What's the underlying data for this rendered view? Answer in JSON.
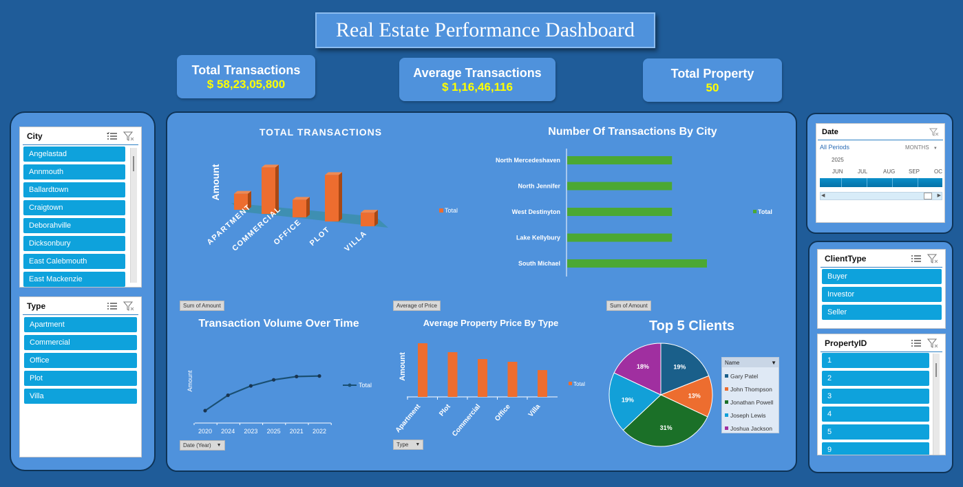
{
  "title": "Real Estate Performance Dashboard",
  "kpis": {
    "total_transactions": {
      "label": "Total Transactions",
      "value": "$ 58,23,05,800"
    },
    "average_transactions": {
      "label": "Average Transactions",
      "value": "$ 1,16,46,116"
    },
    "total_property": {
      "label": "Total Property",
      "value": "50"
    }
  },
  "city_slicer": {
    "title": "City",
    "items": [
      "Angelastad",
      "Annmouth",
      "Ballardtown",
      "Craigtown",
      "Deborahville",
      "Dicksonbury",
      "East Calebmouth",
      "East Mackenzie"
    ]
  },
  "type_slicer": {
    "title": "Type",
    "items": [
      "Apartment",
      "Commercial",
      "Office",
      "Plot",
      "Villa"
    ]
  },
  "date_slicer": {
    "title": "Date",
    "all_periods": "All Periods",
    "level": "MONTHS",
    "year": "2025",
    "months": [
      "JUN",
      "JUL",
      "AUG",
      "SEP",
      "OC"
    ]
  },
  "clienttype_slicer": {
    "title": "ClientType",
    "items": [
      "Buyer",
      "Investor",
      "Seller"
    ]
  },
  "propertyid_slicer": {
    "title": "PropertyID",
    "items": [
      "1",
      "2",
      "3",
      "4",
      "5",
      "9"
    ]
  },
  "colors": {
    "background": "#1f5c99",
    "panel": "#4f92dc",
    "bar_orange": "#ed6d2f",
    "bar_green": "#4ba833",
    "slicer_item": "#0ea2dc",
    "kpi_value": "#ffff00"
  },
  "pivot_buttons": {
    "sum_amount": "Sum of Amount",
    "avg_price": "Average of Price",
    "date_year": "Date (Year)",
    "type": "Type",
    "name_field": "Name"
  },
  "chart_data": [
    {
      "id": "total_transactions",
      "type": "bar",
      "title": "TOTAL TRANSACTIONS",
      "ylabel": "Amount",
      "categories": [
        "APARTMENT",
        "COMMERCIAL",
        "OFFICE",
        "PLOT",
        "VILLA"
      ],
      "series": [
        {
          "name": "Total",
          "values": [
            20,
            58,
            22,
            58,
            17
          ]
        }
      ]
    },
    {
      "id": "transactions_by_city",
      "type": "bar",
      "orientation": "horizontal",
      "title": "Number Of Transactions By City",
      "categories": [
        "North Mercedeshaven",
        "North Jennifer",
        "West Destinyton",
        "Lake Kellybury",
        "South Michael"
      ],
      "series": [
        {
          "name": "Total",
          "values": [
            3,
            3,
            3,
            3,
            4
          ]
        }
      ]
    },
    {
      "id": "volume_over_time",
      "type": "line",
      "title": "Transaction Volume Over Time",
      "ylabel": "Amount",
      "x": [
        "2020",
        "2024",
        "2023",
        "2025",
        "2021",
        "2022"
      ],
      "series": [
        {
          "name": "Total",
          "values": [
            40,
            68,
            85,
            96,
            102,
            103
          ]
        }
      ]
    },
    {
      "id": "avg_price_by_type",
      "type": "bar",
      "title": "Average Property Price By Type",
      "ylabel": "Amount",
      "categories": [
        "Apartment",
        "Plot",
        "Commercial",
        "Office",
        "Villa"
      ],
      "series": [
        {
          "name": "Total",
          "values": [
            78,
            65,
            55,
            51,
            39
          ]
        }
      ]
    },
    {
      "id": "top_clients",
      "type": "pie",
      "title": "Top 5 Clients",
      "categories": [
        "Gary Patel",
        "John Thompson",
        "Jonathan Powell",
        "Joseph Lewis",
        "Joshua Jackson"
      ],
      "values": [
        19,
        13,
        31,
        19,
        18
      ],
      "labels": [
        "19%",
        "13%",
        "31%",
        "19%",
        "18%"
      ],
      "colors": [
        "#1a5f8a",
        "#ed6d2f",
        "#1b7028",
        "#12a0d8",
        "#a02fa0"
      ]
    }
  ]
}
